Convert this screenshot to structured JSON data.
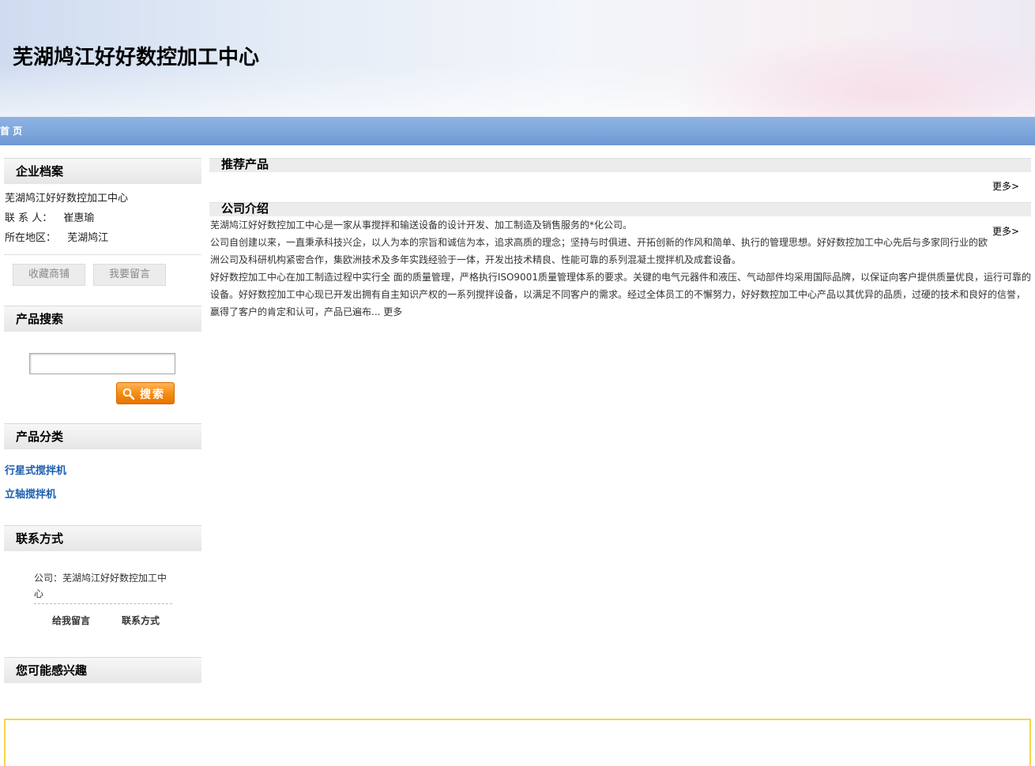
{
  "header": {
    "site_title": "芜湖鸠江好好数控加工中心"
  },
  "nav": {
    "home": "首 页"
  },
  "sidebar": {
    "profile": {
      "title": "企业档案",
      "company": "芜湖鸠江好好数控加工中心",
      "contact_label": "联 系 人：",
      "contact_value": "崔惠瑜",
      "region_label": "所在地区：",
      "region_value": "芜湖鸠江",
      "favorite_button": "收藏商铺",
      "message_button": "我要留言"
    },
    "search": {
      "title": "产品搜索",
      "input_value": "",
      "button_label": "搜索"
    },
    "categories": {
      "title": "产品分类",
      "items": [
        "行星式搅拌机",
        "立轴搅拌机"
      ]
    },
    "contact": {
      "title": "联系方式",
      "company_line": "公司：芜湖鸠江好好数控加工中心",
      "leave_message": "给我留言",
      "contact_info": "联系方式"
    },
    "interest": {
      "title": "您可能感兴趣"
    }
  },
  "main": {
    "recommended": {
      "title": "推荐产品",
      "more": "更多>"
    },
    "intro": {
      "title": "公司介绍",
      "more": "更多>",
      "paragraphs": [
        "芜湖鸠江好好数控加工中心是一家从事搅拌和输送设备的设计开发、加工制造及销售服务的*化公司。",
        "公司自创建以来，一直秉承科技兴企，以人为本的宗旨和诚信为本，追求高质的理念；坚持与时俱进、开拓创新的作风和简单、执行的管理思想。好好数控加工中心先后与多家同行业的欧洲公司及科研机构紧密合作，集欧洲技术及多年实践经验于一体，开发出技术精良、性能可靠的系列混凝土搅拌机及成套设备。",
        "好好数控加工中心在加工制造过程中实行全 面的质量管理，严格执行ISO9001质量管理体系的要求。关键的电气元器件和液压、气动部件均采用国际品牌，以保证向客户提供质量优良，运行可靠的设备。好好数控加工中心现已开发出拥有自主知识产权的一系列搅拌设备，以满足不同客户的需求。经过全体员工的不懈努力，好好数控加工中心产品以其优异的品质，过硬的技术和良好的信誉，赢得了客户的肯定和认可，产品已遍布..."
      ],
      "inline_more": "更多"
    }
  }
}
